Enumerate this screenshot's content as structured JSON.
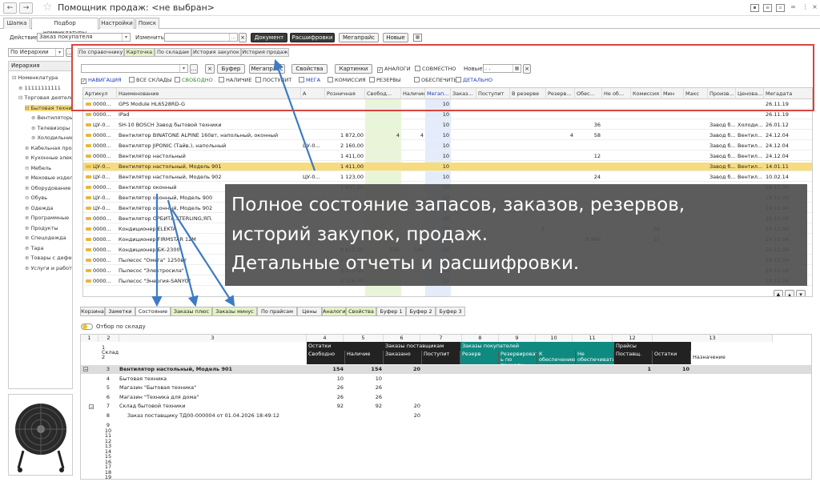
{
  "window": {
    "title": "Помощник продаж: <не выбран>",
    "back": "←",
    "forward": "→",
    "star": "☆"
  },
  "main_tabs": [
    "Шапка",
    "Подбор номенклатуры",
    "Настройки",
    "Поиск"
  ],
  "toolbar": {
    "action_label": "Действие",
    "action_value": "Заказ покупателя",
    "change_label": "Изменить:",
    "btn_document": "Документ",
    "btn_decoding": "Расшифровки",
    "btn_megaprice": "Мегапрайс",
    "btn_new": "Новые",
    "dots": "..."
  },
  "left": {
    "mode": "По Иерархии",
    "tree_header": "Иерархия",
    "items": [
      {
        "text": "Номенклатура",
        "sym": "⊟"
      },
      {
        "text": "11111111111",
        "sym": "⊕"
      },
      {
        "text": "Торговая деятельность",
        "sym": "⊟"
      },
      {
        "text": "Бытовая техника",
        "sym": "⊟"
      },
      {
        "text": "Вентиляторы",
        "sym": "⊕"
      },
      {
        "text": "Телевизоры",
        "sym": "⊕"
      },
      {
        "text": "Холодильники",
        "sym": "⊕"
      },
      {
        "text": "Кабельная продукция",
        "sym": "⊕"
      },
      {
        "text": "Кухонные электроприборы",
        "sym": "⊕"
      },
      {
        "text": "Мебель",
        "sym": "⊖"
      },
      {
        "text": "Меховые изделия",
        "sym": "⊕"
      },
      {
        "text": "Оборудование",
        "sym": "⊕"
      },
      {
        "text": "Обувь",
        "sym": "⊖"
      },
      {
        "text": "Одежда",
        "sym": "⊕"
      },
      {
        "text": "Программные",
        "sym": "⊕"
      },
      {
        "text": "Продукты",
        "sym": "⊕"
      },
      {
        "text": "Спецодежда",
        "sym": "⊕"
      },
      {
        "text": "Тара",
        "sym": "⊕"
      },
      {
        "text": "Товары с дефектом",
        "sym": "⊕"
      },
      {
        "text": "Услуги и работы",
        "sym": "⊕"
      }
    ]
  },
  "subtabs": [
    "По справочнику",
    "Карточка",
    "По складам",
    "История закупок",
    "История продаж"
  ],
  "filter": {
    "btn_buffer": "Буфер",
    "btn_megaprice": "Мегапрайс",
    "btn_props": "Свойства",
    "btn_pictures": "Картинки",
    "analogs": "АНАЛОГИ",
    "compatible": "СОВМЕСТНО",
    "new_label": "Новые:",
    "date_value": ". .",
    "x": "×"
  },
  "checks": [
    {
      "label": "НАВИГАЦИЯ",
      "on": true,
      "blue": true
    },
    {
      "label": "ВСЕ СКЛАДЫ",
      "on": false
    },
    {
      "label": "СВОБОДНО",
      "on": false,
      "green": true
    },
    {
      "label": "НАЛИЧИЕ",
      "on": false
    },
    {
      "label": "ПОСТУПИТ",
      "on": false
    },
    {
      "label": "МЕГА",
      "on": false,
      "blue": true
    },
    {
      "label": "КОМИССИЯ",
      "on": false
    },
    {
      "label": "РЕЗЕРВЫ",
      "on": false
    },
    {
      "label": "ОБЕСПЕЧИТЬ",
      "on": false
    },
    {
      "label": "ДЕТАЛЬНО",
      "on": false,
      "blue": true
    }
  ],
  "grid": {
    "columns": [
      "Артикул",
      "Наименование",
      "",
      "А",
      "Розничная",
      "Свобод...",
      "Наличие",
      "Мегап...",
      "Заказ...",
      "Поступит",
      "В резерве",
      "Резерв...",
      "Обес...",
      "Не об...",
      "Комиссия",
      "Мин",
      "Макс",
      "Произв...",
      "Ценова...",
      "Мегадата"
    ],
    "rows": [
      [
        "0000...",
        "GPS Module HL6528RD-G",
        "",
        "",
        "",
        "",
        "",
        "10",
        "",
        "",
        "",
        "",
        "",
        "",
        "",
        "",
        "",
        "",
        "",
        "26.11.19"
      ],
      [
        "0000...",
        "IPad",
        "",
        "",
        "",
        "",
        "",
        "10",
        "",
        "",
        "",
        "",
        "",
        "",
        "",
        "",
        "",
        "",
        "",
        "26.11.19"
      ],
      [
        "ЦУ-0...",
        "SH-10 BOSCH Завод бытовой техники",
        "",
        "",
        "",
        "",
        "",
        "10",
        "",
        "",
        "",
        "",
        "36",
        "",
        "",
        "",
        "",
        "Завод б...",
        "Холоди...",
        "26.01.12"
      ],
      [
        "0000...",
        "Вентилятор BINATONE ALPINE 160вт, напольный, оконный",
        "",
        "",
        "1 872,00",
        "4",
        "4",
        "10",
        "",
        "",
        "",
        "4",
        "58",
        "",
        "",
        "",
        "",
        "Завод б...",
        "Вентил...",
        "24.12.04"
      ],
      [
        "0000...",
        "Вентилятор JIPONIC (Тайв.), напольный",
        "ЦУ-0...",
        "",
        "2 160,00",
        "",
        "",
        "10",
        "",
        "",
        "",
        "",
        "",
        "",
        "",
        "",
        "",
        "Завод б...",
        "Вентил...",
        "24.12.04"
      ],
      [
        "0000...",
        "Вентилятор настольный",
        "",
        "",
        "1 411,00",
        "",
        "",
        "10",
        "",
        "",
        "",
        "",
        "12",
        "",
        "",
        "",
        "",
        "Завод б...",
        "Вентил...",
        "24.12.04"
      ],
      [
        "ЦУ-0...",
        "Вентилятор настольный, Модель 901",
        "",
        "",
        "1 411,00",
        "",
        "",
        "10",
        "",
        "",
        "",
        "",
        "",
        "",
        "",
        "",
        "",
        "Завод б...",
        "Вентил...",
        "14.01.11"
      ],
      [
        "ЦУ-0...",
        "Вентилятор настольный, Модель 902",
        "ЦУ-0...",
        "",
        "1 123,00",
        "",
        "",
        "10",
        "",
        "",
        "",
        "",
        "24",
        "",
        "",
        "",
        "",
        "Завод б...",
        "Вентил...",
        "10.02.14"
      ],
      [
        "0000...",
        "Вентилятор оконный",
        "",
        "",
        "1 837,00",
        "",
        "",
        "10",
        "",
        "",
        "",
        "",
        "",
        "",
        "",
        "",
        "",
        "",
        "",
        "24.12.04"
      ],
      [
        "ЦУ-0...",
        "Вентилятор оконный, Модель 900",
        "",
        "",
        "",
        "",
        "",
        "10",
        "",
        "",
        "",
        "",
        "",
        "",
        "",
        "",
        "",
        "",
        "",
        "24.12.04"
      ],
      [
        "ЦУ-0...",
        "Вентилятор оконный, Модель 902",
        "",
        "",
        "",
        "",
        "",
        "10",
        "",
        "",
        "",
        "",
        "",
        "",
        "",
        "",
        "",
        "",
        "",
        "24.12.04"
      ],
      [
        "0000...",
        "Вентилятор ОРБИТА,STERLING,ЯП.",
        "",
        "",
        "",
        "",
        "",
        "10",
        "",
        "",
        "",
        "",
        "",
        "",
        "",
        "",
        "",
        "",
        "",
        "24.12.04"
      ],
      [
        "0000...",
        "Кондиционер ELEKTA",
        "",
        "",
        "",
        "",
        "",
        "10",
        "",
        "",
        "2",
        "",
        "",
        "",
        "26",
        "",
        "",
        "",
        "",
        "24.12.04"
      ],
      [
        "0000...",
        "Кондиционер FIRMSTAR 12M",
        "",
        "",
        "",
        "",
        "",
        "10",
        "",
        "",
        "",
        "",
        "9 960",
        "",
        "15",
        "",
        "",
        "",
        "",
        "24.12.04"
      ],
      [
        "0000...",
        "Кондиционер БК-2300",
        "",
        "",
        "9 812,00",
        "545",
        "545",
        "10",
        "",
        "",
        "",
        "",
        "",
        "",
        "",
        "",
        "",
        "",
        "",
        "24.12.04"
      ],
      [
        "0000...",
        "Пылесос \"Омега\" 1250вт",
        "",
        "",
        "2 250,00",
        "",
        "",
        "10",
        "",
        "",
        "",
        "",
        "",
        "",
        "",
        "",
        "",
        "",
        "",
        "24.12.04"
      ],
      [
        "0000...",
        "Пылесос \"Электросила\"",
        "",
        "",
        "3 275,00",
        "",
        "",
        "10",
        "",
        "",
        "",
        "",
        "",
        "",
        "",
        "",
        "",
        "",
        "",
        "24.12.04"
      ],
      [
        "0000...",
        "Пылесос \"Энергия-SANYO\"",
        "",
        "",
        "5 516,00",
        "",
        "",
        "10",
        "",
        "",
        "",
        "",
        "",
        "",
        "",
        "",
        "",
        "",
        "",
        "24.12.04"
      ]
    ]
  },
  "overlay": {
    "line1": "Полное состояние запасов, заказов, резервов,",
    "line2": "историй закупок, продаж.",
    "line3": "Детальные отчеты и расшифровки."
  },
  "bottom_tabs": [
    "Корзина",
    "Заметки",
    "Состояние",
    "Заказы плюс",
    "Заказы минус",
    "По прайсам",
    "Цены",
    "Аналоги",
    "Свойства",
    "Буфер 1",
    "Буфер 2",
    "Буфер 3"
  ],
  "warehouse_toggle": "Отбор по складу",
  "sheet": {
    "col_nums": [
      "1",
      "2",
      "3",
      "4",
      "5",
      "6",
      "7",
      "8",
      "9",
      "10",
      "11",
      "12",
      "13"
    ],
    "group_headers": {
      "ostatki": "Остатки",
      "zakazy_post": "Заказы поставщикам",
      "zakazy_pok": "Заказы покупателей",
      "praisy": "Прайсы"
    },
    "sub_headers": {
      "sklad": "Склад",
      "svobodno": "Свободно",
      "nalichie": "Наличие",
      "zakazano": "Заказано",
      "postupit": "Поступит",
      "rezerv": "Резерв",
      "rezerv_prihod": "Резервироват ь по приходу",
      "k_obesp": "К обеспечению",
      "ne_obesp": "Не обеспечивать",
      "postavsh": "Поставщ.",
      "ostatki": "Остатки",
      "naznachenie": "Назначение"
    },
    "rows": [
      {
        "n": "3",
        "name": "Вентилятор настольный, Модель 901",
        "svob": "154",
        "nal": "154",
        "zak": "20",
        "post": "",
        "postavsh": "1",
        "ost": "10",
        "bold": true
      },
      {
        "n": "4",
        "name": "Бытовая техника",
        "svob": "10",
        "nal": "10",
        "zak": "",
        "post": "",
        "postavsh": "",
        "ost": ""
      },
      {
        "n": "5",
        "name": "Магазин \"Бытовая техника\"",
        "svob": "26",
        "nal": "26",
        "zak": "",
        "post": "",
        "postavsh": "",
        "ost": ""
      },
      {
        "n": "6",
        "name": "Магазин \"Техника для дома\"",
        "svob": "26",
        "nal": "26",
        "zak": "",
        "post": "",
        "postavsh": "",
        "ost": ""
      },
      {
        "n": "7",
        "name": "Склад бытовой техники",
        "svob": "92",
        "nal": "92",
        "zak": "20",
        "post": "",
        "postavsh": "",
        "ost": ""
      },
      {
        "n": "8",
        "name": "Заказ поставщику ТД00-000004 от 01.04.2026 18:49:12",
        "svob": "",
        "nal": "",
        "zak": "20",
        "post": "",
        "postavsh": "",
        "ost": ""
      }
    ],
    "empty_rows": [
      "9",
      "10",
      "11",
      "12",
      "13",
      "14",
      "15",
      "16",
      "17",
      "18",
      "19",
      "20"
    ]
  },
  "colors": {
    "highlight": "#d9443f",
    "overlay": "#4e4e4e",
    "selected": "#f6dc7e",
    "teal": "#0f8a80",
    "arrow": "#3d7bc4"
  }
}
